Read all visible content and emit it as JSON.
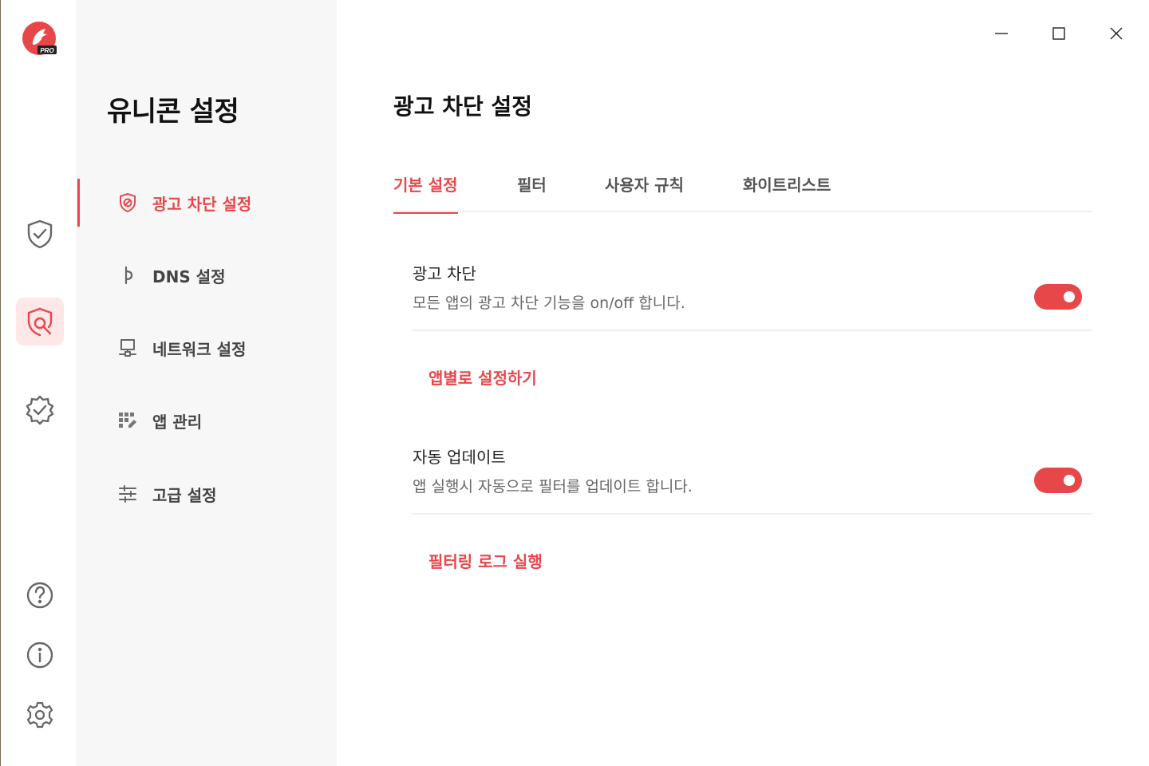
{
  "app": {
    "logo_badge": "PRO"
  },
  "sidebar": {
    "title": "유니콘 설정",
    "items": [
      {
        "label": "광고 차단 설정",
        "icon": "shield-block-icon",
        "active": true
      },
      {
        "label": "DNS 설정",
        "icon": "dns-icon",
        "active": false
      },
      {
        "label": "네트워크 설정",
        "icon": "network-icon",
        "active": false
      },
      {
        "label": "앱 관리",
        "icon": "app-grid-icon",
        "active": false
      },
      {
        "label": "고급 설정",
        "icon": "sliders-icon",
        "active": false
      }
    ]
  },
  "rail": {
    "items": [
      "shield-check-icon",
      "shield-wrench-icon",
      "badge-check-icon"
    ],
    "bottom": [
      "help-icon",
      "info-icon",
      "gear-icon"
    ]
  },
  "main": {
    "title": "광고 차단 설정",
    "tabs": [
      {
        "label": "기본 설정",
        "active": true
      },
      {
        "label": "필터",
        "active": false
      },
      {
        "label": "사용자 규칙",
        "active": false
      },
      {
        "label": "화이트리스트",
        "active": false
      }
    ],
    "settings": [
      {
        "title": "광고 차단",
        "desc": "모든 앱의 광고 차단 기능을 on/off 합니다.",
        "enabled": true
      },
      {
        "title": "자동 업데이트",
        "desc": "앱 실행시 자동으로 필터를 업데이트 합니다.",
        "enabled": true
      }
    ],
    "links": [
      "앱별로 설정하기",
      "필터링 로그 실행"
    ]
  },
  "colors": {
    "accent": "#e8474a",
    "sidebar_bg": "#f7f7f7",
    "active_rail_bg": "#fde7e7"
  }
}
